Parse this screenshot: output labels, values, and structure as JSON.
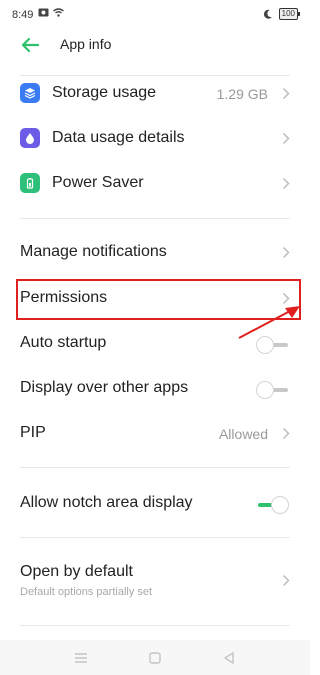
{
  "status_bar": {
    "time": "8:49",
    "battery": "100"
  },
  "header": {
    "title": "App info"
  },
  "sections": {
    "storage": {
      "label": "Storage usage",
      "value": "1.29 GB"
    },
    "data_usage": {
      "label": "Data usage details"
    },
    "power_saver": {
      "label": "Power Saver"
    },
    "manage_notifications": {
      "label": "Manage notifications"
    },
    "permissions": {
      "label": "Permissions"
    },
    "auto_startup": {
      "label": "Auto startup",
      "enabled": false
    },
    "display_over": {
      "label": "Display over other apps",
      "enabled": false
    },
    "pip": {
      "label": "PIP",
      "value": "Allowed"
    },
    "notch": {
      "label": "Allow notch area display",
      "enabled": true
    },
    "open_default": {
      "label": "Open by default",
      "sublabel": "Default options partially set"
    }
  },
  "colors": {
    "accent": "#2ec06b",
    "storage_icon": "#3a7bf4",
    "data_icon": "#6b5be6",
    "power_icon": "#2ec07a",
    "annotation": "#e0201e"
  }
}
